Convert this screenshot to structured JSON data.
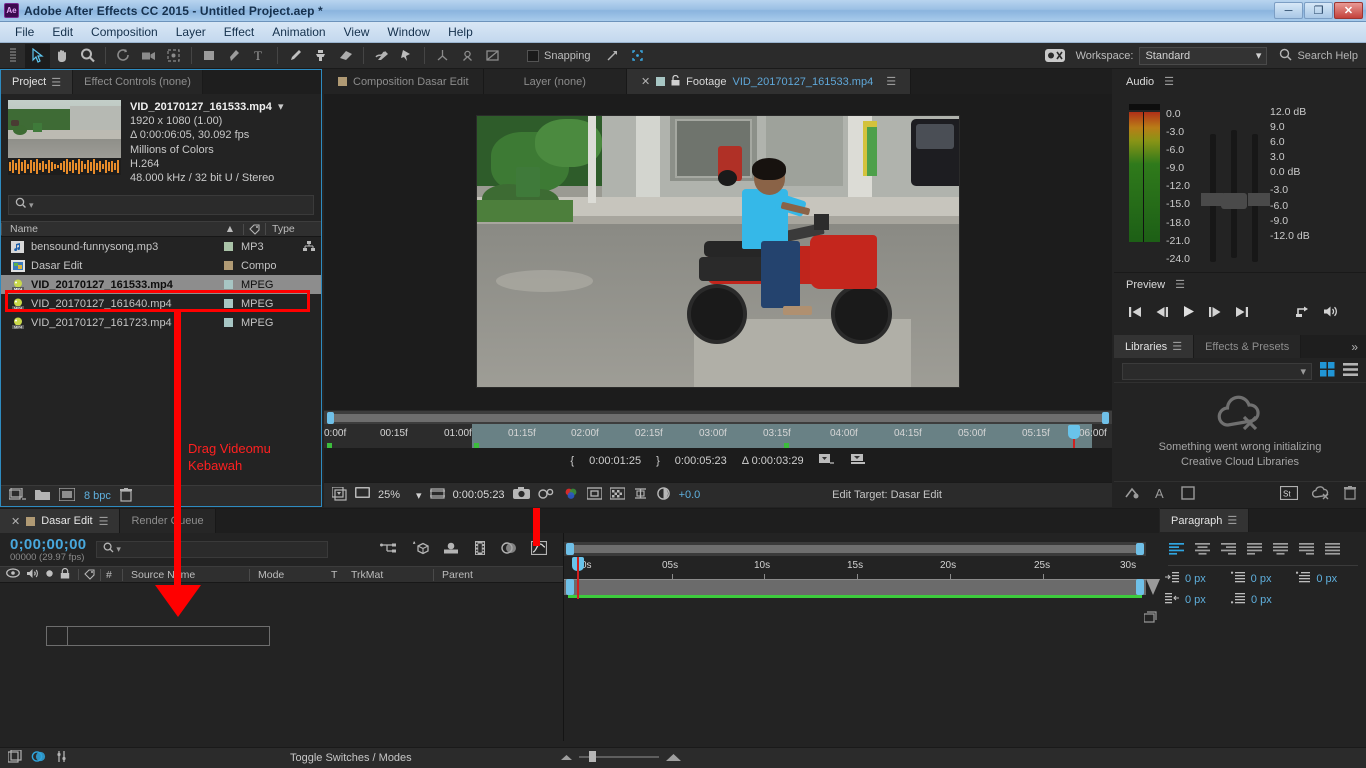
{
  "window": {
    "title": "Adobe After Effects CC 2015 - Untitled Project.aep *",
    "app_icon_label": "Ae",
    "minimize": "─",
    "restore": "❐",
    "close": "✕"
  },
  "menubar": {
    "items": [
      "File",
      "Edit",
      "Composition",
      "Layer",
      "Effect",
      "Animation",
      "View",
      "Window",
      "Help"
    ]
  },
  "toolbar": {
    "tools": [
      {
        "name": "home-handle-icon"
      },
      {
        "name": "selection-tool-icon"
      },
      {
        "name": "hand-tool-icon"
      },
      {
        "name": "zoom-tool-icon"
      },
      {
        "name": "rotation-tool-icon"
      },
      {
        "name": "camera-tool-icon"
      },
      {
        "name": "pan-behind-tool-icon"
      },
      {
        "name": "shape-tool-icon"
      },
      {
        "name": "pen-tool-icon"
      },
      {
        "name": "type-tool-icon"
      },
      {
        "name": "brush-tool-icon"
      },
      {
        "name": "clone-stamp-tool-icon"
      },
      {
        "name": "eraser-tool-icon"
      },
      {
        "name": "roto-brush-tool-icon"
      },
      {
        "name": "puppet-pin-tool-icon"
      },
      {
        "name": "unified-camera-icon"
      },
      {
        "name": "orbit-camera-icon"
      },
      {
        "name": "track-camera-icon"
      }
    ],
    "snapping_label": "Snapping",
    "workspace_label": "Workspace:",
    "workspace_value": "Standard",
    "search_help": "Search Help"
  },
  "project_panel": {
    "tabs": [
      {
        "label": "Project",
        "selected": true
      },
      {
        "label": "Effect Controls (none)",
        "selected": false
      }
    ],
    "selected_asset": {
      "name": "VID_20170127_161533.mp4",
      "resolution": "1920 x 1080 (1.00)",
      "duration": "Δ 0:00:06:05, 30.092 fps",
      "colors": "Millions of Colors",
      "codec": "H.264",
      "audio": "48.000 kHz / 32 bit U / Stereo"
    },
    "search_placeholder": "",
    "columns": [
      "Name",
      "Type"
    ],
    "files": [
      {
        "name": "bensound-funnysong.mp3",
        "type": "MP3",
        "icon": "audio-file-icon",
        "swatch": "#a9c2a7",
        "selected": false
      },
      {
        "name": "Dasar Edit",
        "type": "Compo",
        "icon": "composition-icon",
        "swatch": "#b09a74",
        "selected": false
      },
      {
        "name": "VID_20170127_161533.mp4",
        "type": "MPEG",
        "icon": "video-file-icon",
        "swatch": "#a7c6c4",
        "selected": true
      },
      {
        "name": "VID_20170127_161640.mp4",
        "type": "MPEG",
        "icon": "video-file-icon",
        "swatch": "#a7c6c4",
        "selected": false
      },
      {
        "name": "VID_20170127_161723.mp4",
        "type": "MPEG",
        "icon": "video-file-icon",
        "swatch": "#a7c6c4",
        "selected": false
      }
    ],
    "footer": {
      "bit_depth": "8 bpc",
      "icons": [
        "interpret-footage-icon",
        "new-folder-icon",
        "new-composition-icon",
        "delete-icon"
      ]
    }
  },
  "viewer_panel": {
    "tabs": [
      {
        "label": "Composition Dasar Edit",
        "selected": false,
        "swatch": "#b09a74"
      },
      {
        "label": "Layer (none)",
        "selected": false,
        "swatch": ""
      },
      {
        "label_prefix": "Footage ",
        "label": "VID_20170127_161533.mp4",
        "selected": true,
        "swatch": "#a7c6c4"
      }
    ],
    "ruler_labels": [
      "0:00f",
      "00:15f",
      "01:00f",
      "01:15f",
      "02:00f",
      "02:15f",
      "03:00f",
      "03:15f",
      "04:00f",
      "04:15f",
      "05:00f",
      "05:15f",
      "06:00f"
    ],
    "in_point": "0:00:01:25",
    "out_point": "0:00:05:23",
    "duration": "Δ 0:00:03:29",
    "footer": {
      "zoom": "25%",
      "timecode": "0:00:05:23",
      "exposure": "+0.0",
      "edit_target": "Edit Target: Dasar Edit"
    }
  },
  "audio_panel": {
    "title": "Audio",
    "meter_scale": [
      "0.0",
      "-3.0",
      "-6.0",
      "-9.0",
      "-12.0",
      "-15.0",
      "-18.0",
      "-21.0",
      "-24.0"
    ],
    "db_scale": [
      "12.0 dB",
      "9.0",
      "6.0",
      "3.0",
      "0.0 dB",
      "-3.0",
      "-6.0",
      "-9.0",
      "-12.0 dB"
    ],
    "left_value": "0",
    "right_value": "0"
  },
  "preview_panel": {
    "title": "Preview",
    "controls": [
      "first-frame-icon",
      "previous-frame-icon",
      "play-icon",
      "next-frame-icon",
      "last-frame-icon",
      "loop-icon",
      "mute-audio-icon"
    ]
  },
  "libraries_panel": {
    "tabs": [
      {
        "label": "Libraries",
        "selected": true
      },
      {
        "label": "Effects & Presets",
        "selected": false
      }
    ],
    "overflow": "»",
    "message_line1": "Something went wrong initializing",
    "message_line2": "Creative Cloud Libraries",
    "footer_icons": [
      "add-graphic-icon",
      "add-text-icon",
      "add-color-icon",
      "stock-icon",
      "cc-error-icon",
      "delete-icon"
    ]
  },
  "paragraph_panel": {
    "title": "Paragraph",
    "align_buttons": [
      "align-left",
      "align-center",
      "align-right",
      "justify-last-left",
      "justify-last-center",
      "justify-last-right",
      "justify-all"
    ],
    "indents": [
      {
        "icon": "indent-left-icon",
        "value": "0 px"
      },
      {
        "icon": "space-before-icon",
        "value": "0 px"
      },
      {
        "icon": "first-line-indent-icon",
        "value": "0 px"
      },
      {
        "icon": "indent-right-icon",
        "value": "0 px"
      },
      {
        "icon": "space-after-icon",
        "value": "0 px"
      }
    ]
  },
  "timeline_panel": {
    "tabs": [
      {
        "label": "Dasar Edit",
        "selected": true,
        "closable": true,
        "swatch": "#b09a74"
      },
      {
        "label": "Render Queue",
        "selected": false,
        "closable": false,
        "swatch": ""
      }
    ],
    "current_time": "0;00;00;00",
    "frame_info": "00000 (29.97 fps)",
    "search_placeholder": "",
    "toolbar_icons": [
      "composition-mini-flowchart-icon",
      "draft-3d-icon",
      "hide-shy-layers-icon",
      "frame-blending-icon",
      "motion-blur-icon",
      "graph-editor-icon"
    ],
    "columns": [
      "#",
      "Source Name",
      "Mode",
      "T",
      "TrkMat",
      "Parent"
    ],
    "ruler_labels": [
      "0s",
      "05s",
      "10s",
      "15s",
      "20s",
      "25s",
      "30s"
    ]
  },
  "status_bar": {
    "toggle_label": "Toggle Switches / Modes"
  },
  "annotation": {
    "text_line1": "Drag Videomu",
    "text_line2": "Kebawah",
    "color": "#ff0000"
  }
}
